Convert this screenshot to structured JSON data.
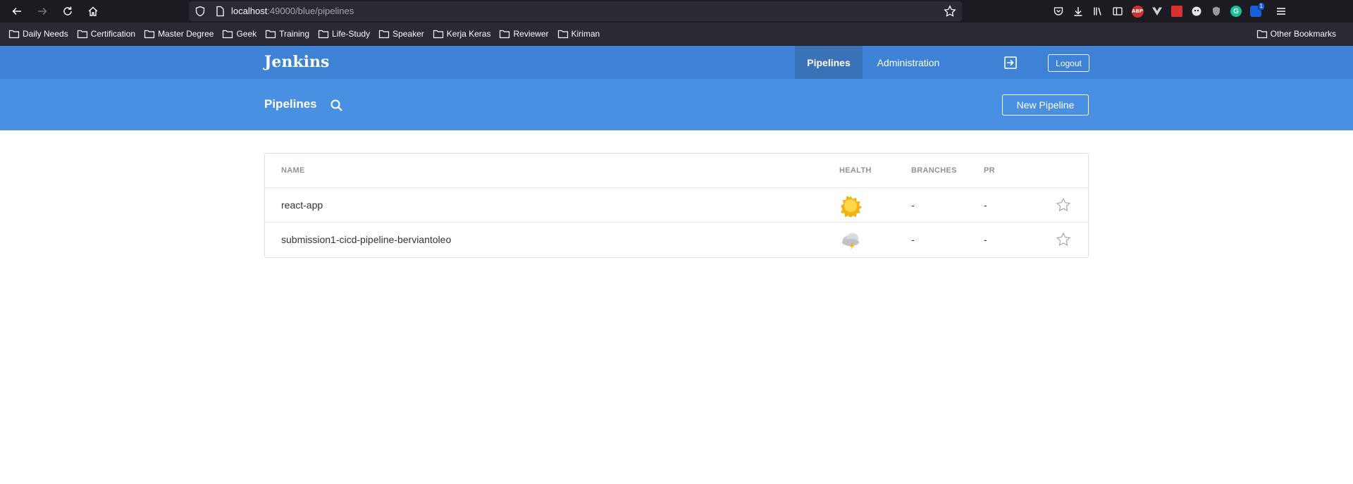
{
  "browser": {
    "url_host": "localhost",
    "url_rest": ":49000/blue/pipelines",
    "bookmarks": [
      "Daily Needs",
      "Certification",
      "Master Degree",
      "Geek",
      "Training",
      "Life-Study",
      "Speaker",
      "Kerja Keras",
      "Reviewer",
      "Kiriman"
    ],
    "other_bookmarks": "Other Bookmarks",
    "extensions": {
      "abp_label": "ABP",
      "grammarly_label": "G",
      "bitwarden_badge": "1"
    }
  },
  "jenkins": {
    "logo": "Jenkins",
    "nav": {
      "pipelines": "Pipelines",
      "administration": "Administration",
      "logout": "Logout"
    },
    "page_title": "Pipelines",
    "new_pipeline_label": "New Pipeline",
    "table": {
      "headers": {
        "name": "NAME",
        "health": "HEALTH",
        "branches": "BRANCHES",
        "pr": "PR"
      },
      "rows": [
        {
          "name": "react-app",
          "health": "sunny",
          "branches": "-",
          "pr": "-"
        },
        {
          "name": "submission1-cicd-pipeline-berviantoleo",
          "health": "stormy",
          "branches": "-",
          "pr": "-"
        }
      ]
    }
  }
}
